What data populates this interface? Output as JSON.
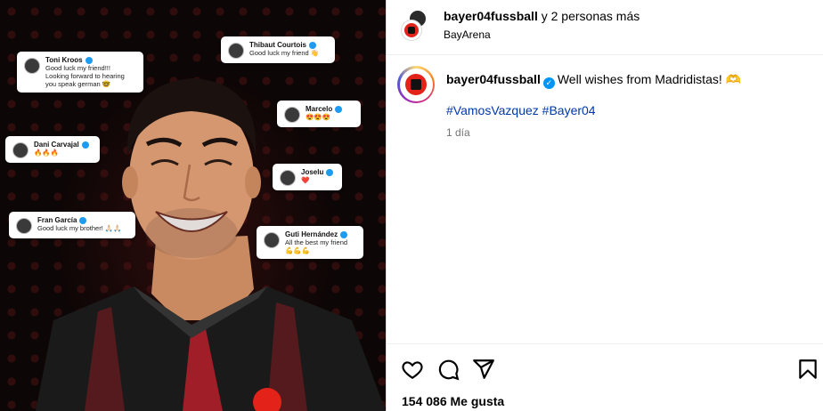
{
  "post": {
    "header": {
      "username": "bayer04fussball",
      "collab_text": "y 2 personas más",
      "location": "BayArena"
    },
    "caption": {
      "username": "bayer04fussball",
      "text": "Well wishes from Madridistas! 🫶",
      "hashtags": [
        "#VamosVazquez",
        "#Bayer04"
      ],
      "time": "1 día"
    },
    "likes": "154 086 Me gusta",
    "icons": {
      "like": "heart-icon",
      "comment": "comment-icon",
      "share": "send-icon",
      "save": "bookmark-icon"
    },
    "colors": {
      "link": "#00376b",
      "verified": "#0095f6",
      "brand_red": "#e32219"
    }
  },
  "media": {
    "comments": [
      {
        "name": "Toni Kroos",
        "text": "Good luck my friend!!!\nLooking forward to hearing\nyou speak german 🤓"
      },
      {
        "name": "Thibaut Courtois",
        "text": "Good luck my friend 👋"
      },
      {
        "name": "Marcelo",
        "text": "😍😍😍"
      },
      {
        "name": "Dani Carvajal",
        "text": "🔥🔥🔥"
      },
      {
        "name": "Joselu",
        "text": "❤️"
      },
      {
        "name": "Fran García",
        "text": "Good luck my brother! 🙏🏻🙏🏻"
      },
      {
        "name": "Guti Hernández",
        "text": "All the best my friend\n💪💪💪"
      }
    ]
  }
}
